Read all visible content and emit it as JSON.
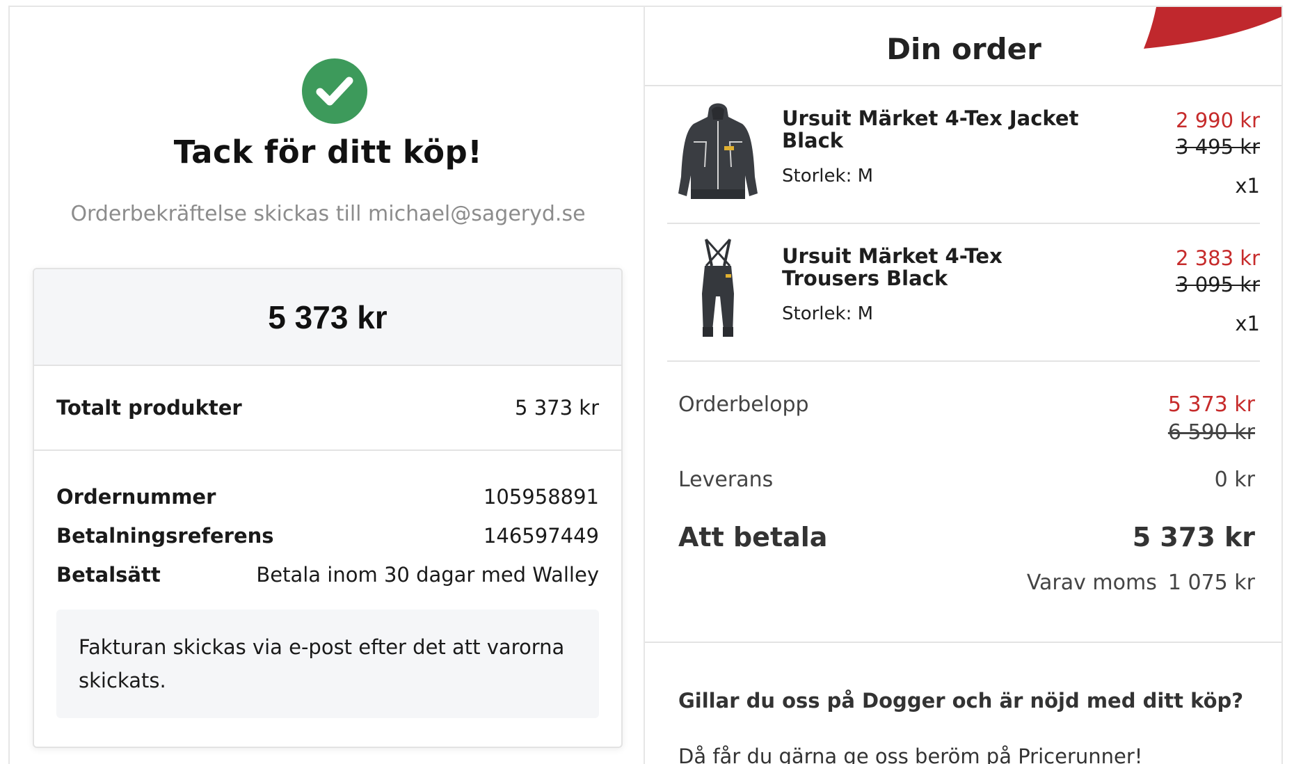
{
  "confirmation": {
    "title": "Tack för ditt köp!",
    "message": "Orderbekräftelse skickas till michael@sageryd.se",
    "icon": "check-circle-icon",
    "icon_color": "#3d9a5b"
  },
  "summary": {
    "total": "5 373 kr",
    "products_label": "Totalt produkter",
    "products_value": "5 373 kr",
    "details": [
      {
        "label": "Ordernummer",
        "value": "105958891"
      },
      {
        "label": "Betalningsreferens",
        "value": "146597449"
      },
      {
        "label": "Betalsätt",
        "value": "Betala inom 30 dagar med Walley"
      }
    ],
    "invoice_note": "Fakturan skickas via e-post efter det att varorna skickats."
  },
  "order": {
    "title": "Din order",
    "items": [
      {
        "name": "Ursuit Märket 4-Tex Jacket Black",
        "size": "Storlek: M",
        "price": "2 990 kr",
        "original_price": "3 495 kr",
        "quantity": "x1",
        "image": "jacket-image"
      },
      {
        "name": "Ursuit Märket 4-Tex Trousers Black",
        "size": "Storlek: M",
        "price": "2 383 kr",
        "original_price": "3 095 kr",
        "quantity": "x1",
        "image": "trousers-image"
      }
    ],
    "order_amount_label": "Orderbelopp",
    "order_amount": "5 373 kr",
    "order_amount_original": "6 590 kr",
    "delivery_label": "Leverans",
    "delivery_value": "0 kr",
    "pay_label": "Att betala",
    "pay_value": "5 373 kr",
    "vat_label": "Varav moms",
    "vat_value": "1 075 kr"
  },
  "review": {
    "heading": "Gillar du oss på Dogger och är nöjd med ditt köp?",
    "text": "Då får du gärna ge oss beröm på Pricerunner!"
  },
  "colors": {
    "sale_red": "#c62b2b",
    "success_green": "#3d9a5b",
    "ribbon_red": "#c0282d"
  }
}
